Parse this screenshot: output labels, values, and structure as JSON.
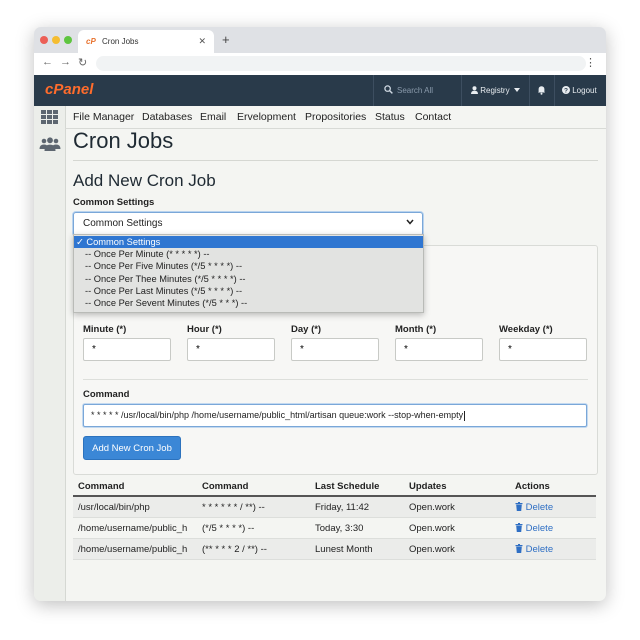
{
  "browser": {
    "tab_title": "Cron Jobs",
    "tab_logo": "cP",
    "close_glyph": "✕",
    "new_tab_glyph": "+",
    "back_glyph": "←",
    "forward_glyph": "→",
    "reload_glyph": "↻",
    "menu_glyph": "⋮",
    "dot_colors": [
      "#ec5f57",
      "#f5bd31",
      "#5ec53f"
    ]
  },
  "header": {
    "logo": "cPanel",
    "search_placeholder": "Search All",
    "registry_label": "Registry",
    "logout_label": "Logout",
    "accent_color": "#ff6c2c",
    "bar_color": "#293a4a"
  },
  "nav": [
    "File Manager",
    "Databases",
    "Email",
    "Ervelopment",
    "Propositories",
    "Status",
    "Contact"
  ],
  "page": {
    "title": "Cron Jobs",
    "section_title": "Add New Cron Job",
    "common_settings_label": "Common Settings",
    "selected_setting": "Common Settings"
  },
  "dropdown": {
    "options": [
      "✓ Common Settings",
      "-- Once Per Minute (* * * * *) --",
      "-- Once Per Five Minutes (*/5 * * * *) --",
      "-- Once Per Thee Minutes (*/5 * * * *) --",
      "-- Once Per Last Minutes (*/5 * * * *) --",
      "-- Once Per Sevent Minutes (*/5 * * *) --"
    ],
    "selected_index": 0
  },
  "fields": [
    {
      "label": "Minute (*)",
      "value": "*"
    },
    {
      "label": "Hour (*)",
      "value": "*"
    },
    {
      "label": "Day (*)",
      "value": "*"
    },
    {
      "label": "Month (*)",
      "value": "*"
    },
    {
      "label": "Weekday (*)",
      "value": "*"
    }
  ],
  "command": {
    "label": "Command",
    "value": "* * * * * /usr/local/bin/php /home/username/public_html/artisan queue:work --stop-when-empty"
  },
  "add_button_label": "Add New Cron Job",
  "table": {
    "headers": [
      "Command",
      "Command",
      "Last Schedule",
      "Updates",
      "Actions"
    ],
    "rows": [
      {
        "cmd": "/usr/local/bin/php",
        "schedule": "* * * * * * / **) --",
        "last": "Friday, 11:42",
        "updates": "Open.work",
        "action": "Delete"
      },
      {
        "cmd": "/home/username/public_h",
        "schedule": "(*/5 * * * *) --",
        "last": "Today, 3:30",
        "updates": "Open.work",
        "action": "Delete"
      },
      {
        "cmd": "/home/username/public_h",
        "schedule": "(** * * * 2 / **) --",
        "last": "Lunest Month",
        "updates": "Open.work",
        "action": "Delete"
      }
    ]
  }
}
